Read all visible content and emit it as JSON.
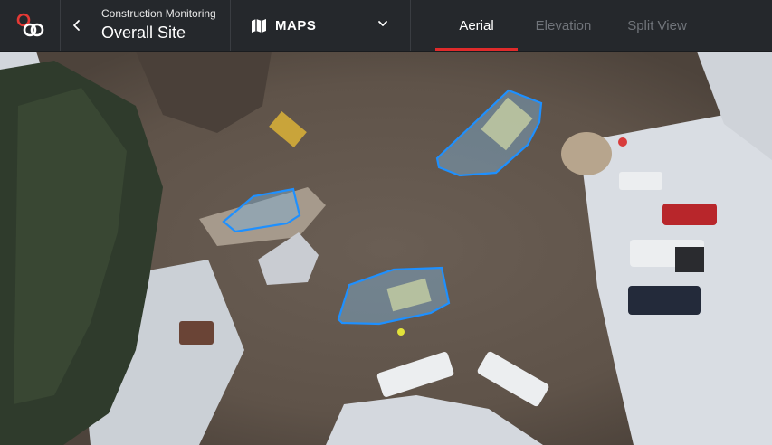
{
  "header": {
    "logo_icon": "app-logo-icon",
    "back_icon": "chevron-left-icon",
    "breadcrumb": "Construction Monitoring",
    "project_title": "Overall Site",
    "view_selector": {
      "label": "MAPS",
      "icon": "map-icon",
      "dropdown_icon": "chevron-down-icon"
    },
    "tabs": [
      {
        "label": "Aerial",
        "active": true
      },
      {
        "label": "Elevation",
        "active": false
      },
      {
        "label": "Split View",
        "active": false
      }
    ]
  },
  "map": {
    "view": "aerial",
    "highlight_color": "#1e90ff",
    "tab_accent_color": "#e02b2b"
  }
}
